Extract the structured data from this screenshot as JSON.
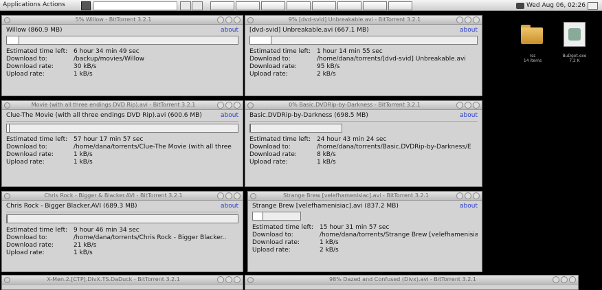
{
  "topbar": {
    "applications": "Applications",
    "actions": "Actions",
    "clock": "Wed Aug 06, 02:26"
  },
  "desktop": {
    "folder_name": "rss",
    "folder_sub": "14 items",
    "pkg_name": "BuDget.exe",
    "pkg_sub": "7.2 K"
  },
  "windows": [
    {
      "title": "5% Willow - BitTorrent 3.2.1",
      "file": "Willow (860.9 MB)",
      "about": "about",
      "progress": 0.05,
      "eta_label": "Estimated time left:",
      "eta": "6 hour 34 min 49 sec",
      "dl_to_label": "Download to:",
      "dl_to": "/backup/movies/Willow",
      "dl_rate_label": "Download rate:",
      "dl_rate": "30 kB/s",
      "ul_rate_label": "Upload rate:",
      "ul_rate": "1 kB/s"
    },
    {
      "title": "9% [dvd-svid] Unbreakable.avi - BitTorrent 3.2.1",
      "file": "[dvd-svid] Unbreakable.avi (667.1 MB)",
      "about": "about",
      "progress": 0.09,
      "eta_label": "Estimated time left:",
      "eta": "1 hour 14 min 55 sec",
      "dl_to_label": "Download to:",
      "dl_to": "/home/dana/torrents/[dvd-svid] Unbreakable.avi",
      "dl_rate_label": "Download rate:",
      "dl_rate": "95 kB/s",
      "ul_rate_label": "Upload rate:",
      "ul_rate": "2 kB/s"
    },
    {
      "title": "Movie (with all three endings DVD Rip).avi - BitTorrent 3.2.1",
      "file": "Clue-The Movie (with all three endings DVD Rip).avi (600.6 MB)",
      "about": "about",
      "progress": 0.0,
      "eta_label": "Estimated time left:",
      "eta": "57 hour 17 min 57 sec",
      "dl_to_label": "Download to:",
      "dl_to": "/home/dana/torrents/Clue-The Movie (with all three",
      "dl_rate_label": "Download rate:",
      "dl_rate": "1 kB/s",
      "ul_rate_label": "Upload rate:",
      "ul_rate": "1 kB/s"
    },
    {
      "title": "0% Basic.DVDRip-by-Darkness - BitTorrent 3.2.1",
      "file": "Basic.DVDRip-by-Darkness (698.5 MB)",
      "about": "about",
      "progress": 0.0,
      "eta_label": "Estimated time left:",
      "eta": "24 hour 43 min 24 sec",
      "dl_to_label": "Download to:",
      "dl_to": "/home/dana/torrents/Basic.DVDRip-by-Darkness/E",
      "dl_rate_label": "Download rate:",
      "dl_rate": "8 kB/s",
      "ul_rate_label": "Upload rate:",
      "ul_rate": "1 kB/s"
    },
    {
      "title": "Chris Rock - Bigger & Blacker.AVI - BitTorrent 3.2.1",
      "file": "Chris Rock - Bigger  Blacker.AVI (689.3 MB)",
      "about": "about",
      "progress": 0.0,
      "eta_label": "Estimated time left:",
      "eta": "9 hour 46 min 34 sec",
      "dl_to_label": "Download to:",
      "dl_to": "/home/dana/torrents/Chris Rock - Bigger  Blacker..",
      "dl_rate_label": "Download rate:",
      "dl_rate": "21 kB/s",
      "ul_rate_label": "Upload rate:",
      "ul_rate": "1 kB/s"
    },
    {
      "title": "Strange Brew [velefhamenisiac].avi - BitTorrent 3.2.1",
      "file": "Strange Brew [velefhamenisiac].avi (837.2 MB)",
      "about": "about",
      "progress": 0.04,
      "eta_label": "Estimated time left:",
      "eta": "15 hour 31 min 57 sec",
      "dl_to_label": "Download to:",
      "dl_to": "/home/dana/torrents/Strange Brew [velefhamenisiac",
      "dl_rate_label": "Download rate:",
      "dl_rate": "1 kB/s",
      "ul_rate_label": "Upload rate:",
      "ul_rate": "2 kB/s"
    }
  ],
  "bottom_windows": [
    {
      "title": "X-Men.2.[CTP].DivX.TS.DaDuck - BitTorrent 3.2.1"
    },
    {
      "title": "98% Dazed and Confused (Divx).avi - BitTorrent 3.2.1"
    }
  ]
}
